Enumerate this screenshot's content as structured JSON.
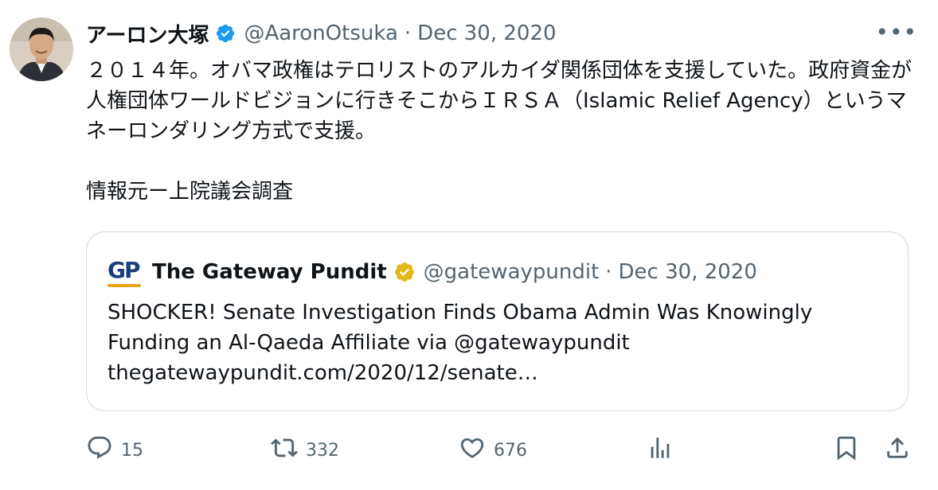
{
  "tweet": {
    "author": {
      "display_name": "アーロン大塚",
      "handle": "@AaronOtsuka",
      "verified_icon": "verified-badge-blue"
    },
    "separator": "·",
    "date": "Dec 30, 2020",
    "more_icon": "more-horizontal-icon",
    "more_label": "•••",
    "text": "２０１４年。オバマ政権はテロリストのアルカイダ関係団体を支援していた。政府資金が人権団体ワールドビジョンに行きそこからＩＲＳＡ（Islamic Relief Agency）というマネーロンダリング方式で支援。\n\n情報元ー上院議会調査"
  },
  "quote": {
    "logo_text": "GP",
    "display_name": "The Gateway Pundit",
    "verified_icon": "verified-badge-gold",
    "handle": "@gatewaypundit",
    "separator": "·",
    "date": "Dec 30, 2020",
    "lines": [
      "SHOCKER! Senate Investigation Finds Obama Admin Was Knowingly",
      "Funding an Al-Qaeda Affiliate via @gatewaypundit",
      "thegatewaypundit.com/2020/12/senate…"
    ]
  },
  "actions": {
    "reply": {
      "icon": "reply-icon",
      "count": "15"
    },
    "retweet": {
      "icon": "retweet-icon",
      "count": "332"
    },
    "like": {
      "icon": "heart-icon",
      "count": "676"
    },
    "views": {
      "icon": "analytics-icon"
    },
    "bookmark": {
      "icon": "bookmark-icon"
    },
    "share": {
      "icon": "share-icon"
    }
  },
  "colors": {
    "text": "#0f1419",
    "secondary": "#536471",
    "verified_blue": "#1d9bf0",
    "verified_gold": "#e2b719",
    "border": "#cfd9de"
  }
}
